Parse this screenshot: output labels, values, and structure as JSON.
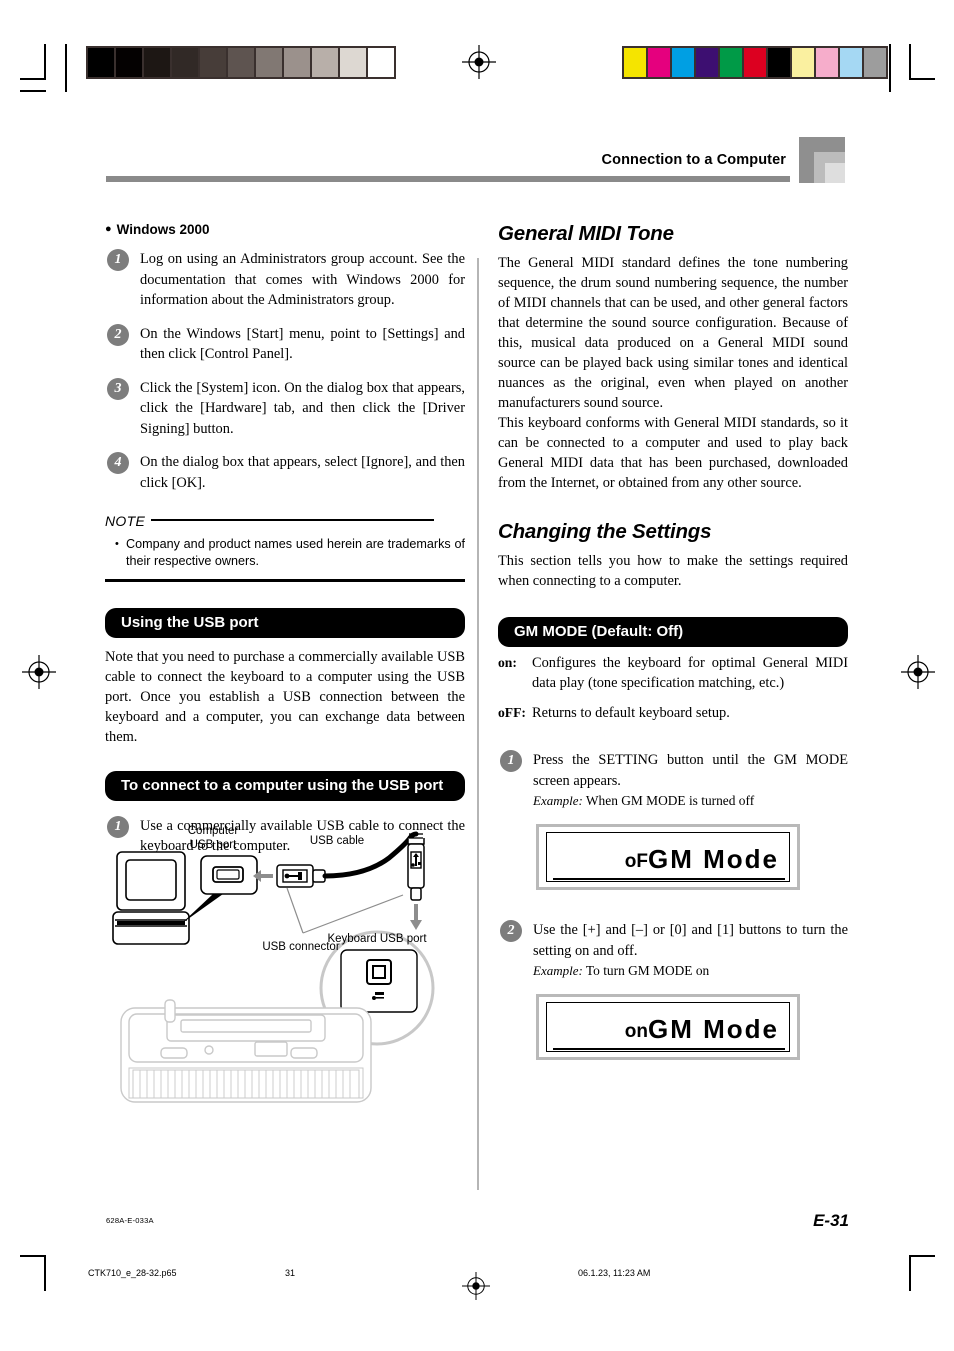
{
  "header": {
    "title": "Connection to a Computer"
  },
  "left_column": {
    "windows_heading": "Windows 2000",
    "windows_steps": [
      "Log on using an Administrators group account. See the documentation that comes with Windows 2000 for information about the Administrators group.",
      "On the Windows [Start] menu, point to [Settings] and then click [Control Panel].",
      "Click the [System] icon. On the dialog box that appears, click the [Hardware] tab, and then click the [Driver Signing] button.",
      "On the dialog box that appears, select [Ignore], and then click [OK]."
    ],
    "step_numbers": [
      "1",
      "2",
      "3",
      "4"
    ],
    "note": {
      "caption": "NOTE",
      "items": [
        "Company and product names used herein are trademarks of their respective owners."
      ]
    },
    "usb_port_heading": "Using the USB port",
    "usb_port_body": "Note that you need to purchase a commercially available USB cable to connect the keyboard to a computer using the USB port. Once you establish a USB connection between the keyboard and a computer, you can exchange data between them.",
    "connect_heading": "To connect to a computer using the USB port",
    "connect_step_number": "1",
    "connect_step": "Use a commercially available USB cable to connect the keyboard to the computer.",
    "diagram_labels": {
      "computer_usb_port": "Computer\nUSB port",
      "computer_usb_port_line1": "Computer",
      "computer_usb_port_line2": "USB port",
      "usb_cable": "USB cable",
      "usb_connector": "USB connector",
      "keyboard_usb_port": "Keyboard USB port",
      "port_icon_label": "USB"
    }
  },
  "right_column": {
    "gm_tone_title": "General MIDI Tone",
    "gm_tone_paragraphs": [
      "The General MIDI standard defines the tone numbering sequence, the drum sound numbering sequence, the number of MIDI channels that can be used, and other general factors that determine the sound source configuration. Because of this, musical data produced on a General MIDI sound source can be played back using similar tones and identical nuances as the original, even when played on another manufacturers sound source.",
      "This keyboard conforms with General MIDI standards, so it can be connected to a computer and used to play back General MIDI data that has been purchased, downloaded from the Internet, or obtained from any other source."
    ],
    "changing_settings_title": "Changing the Settings",
    "changing_settings_body": "This section tells you how to make the settings required when connecting to a computer.",
    "gm_mode_heading": "GM MODE (Default: Off)",
    "gm_mode_options": [
      {
        "key": "on:",
        "text": "Configures the keyboard for optimal General MIDI data play (tone specification matching, etc.)"
      },
      {
        "key": "oFF:",
        "text": "Returns to default keyboard setup."
      }
    ],
    "steps": [
      {
        "number": "1",
        "text": "Press the SETTING button until the GM MODE screen appears.",
        "example_label": "Example:",
        "example_text": "When GM MODE is turned off",
        "lcd_prefix": "oF",
        "lcd_text": "GM Mode"
      },
      {
        "number": "2",
        "text": "Use the [+] and [–] or [0] and [1] buttons to turn the setting on and off.",
        "example_label": "Example:",
        "example_text": "To turn GM MODE on",
        "lcd_prefix": "on",
        "lcd_text": "GM Mode"
      }
    ]
  },
  "footer": {
    "doc_code": "628A-E-033A",
    "page_label": "E-31",
    "print_file": "CTK710_e_28-32.p65",
    "print_page": "31",
    "print_timestamp": "06.1.23, 11:23 AM"
  },
  "calibration": {
    "grayscale_patches": [
      "#000000",
      "#040101",
      "#1d1714",
      "#312926",
      "#473d39",
      "#5e5450",
      "#817873",
      "#9b918c",
      "#b8afa9",
      "#ddd8d2",
      "#ffffff"
    ],
    "color_patches": [
      "#f5e400",
      "#e5007e",
      "#009fe3",
      "#3d0f71",
      "#009a47",
      "#dc0020",
      "#000000",
      "#faf0a0",
      "#f6adcb",
      "#a5d8f3",
      "#9d9d9d"
    ]
  },
  "colors": {
    "header_rule": "#8a8a8a",
    "bar_background": "#000000",
    "step_circle": "#7d7d7d",
    "column_divider": "#b5b5b5"
  }
}
